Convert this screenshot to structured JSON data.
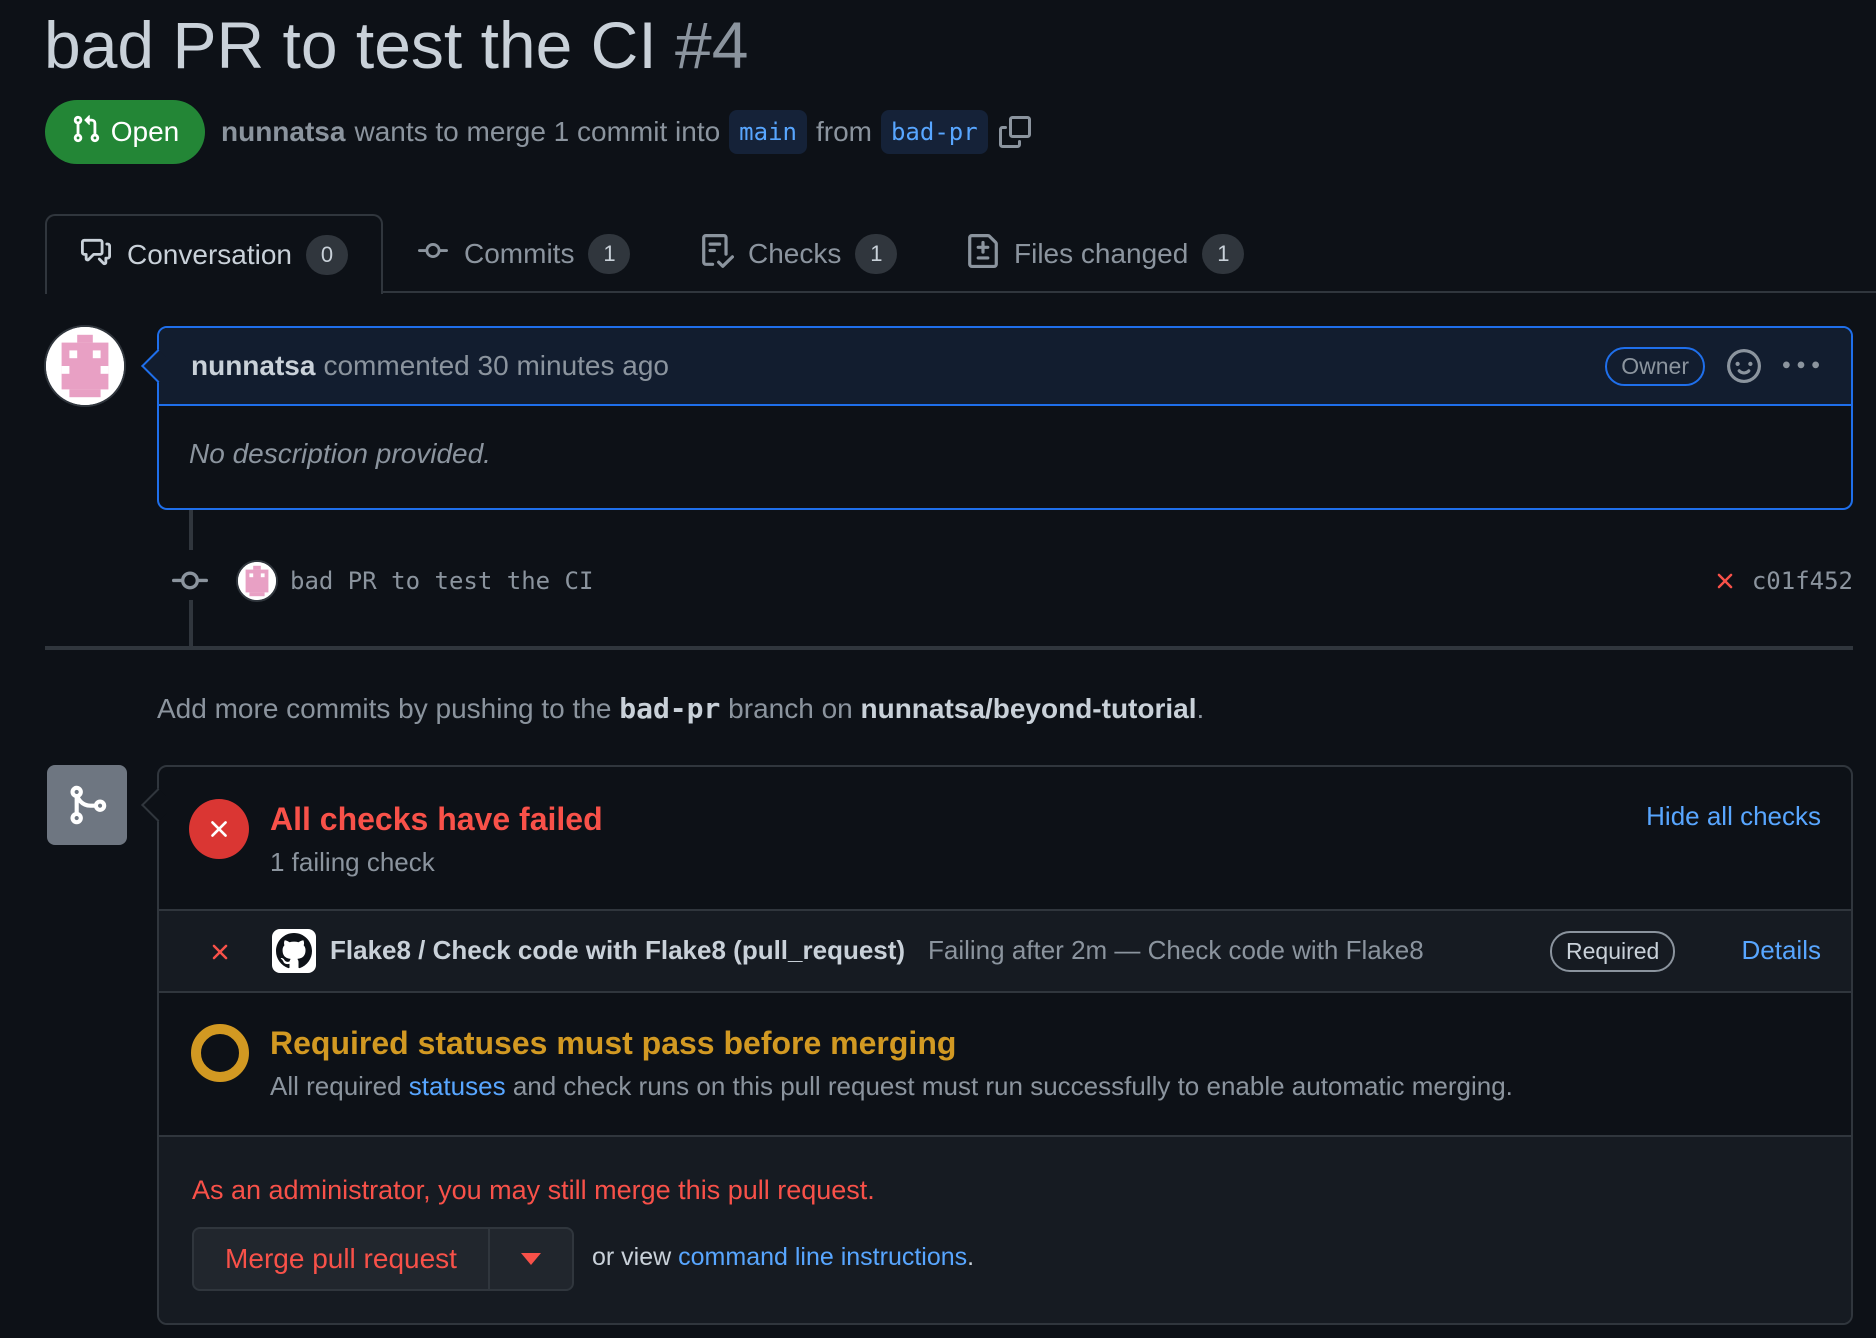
{
  "pr": {
    "title": "bad PR to test the CI",
    "number": "#4",
    "state": "Open",
    "author": "nunnatsa",
    "merge_text": "wants to merge 1 commit into",
    "base_branch": "main",
    "from_text": "from",
    "head_branch": "bad-pr"
  },
  "tabs": [
    {
      "label": "Conversation",
      "count": "0"
    },
    {
      "label": "Commits",
      "count": "1"
    },
    {
      "label": "Checks",
      "count": "1"
    },
    {
      "label": "Files changed",
      "count": "1"
    }
  ],
  "comment": {
    "author": "nunnatsa",
    "action": "commented 30 minutes ago",
    "role": "Owner",
    "body": "No description provided."
  },
  "commit": {
    "message": "bad PR to test the CI",
    "sha": "c01f452"
  },
  "push_note": {
    "prefix": "Add more commits by pushing to the",
    "branch": "bad-pr",
    "middle": "branch on",
    "repo": "nunnatsa/beyond-tutorial",
    "suffix": "."
  },
  "checks": {
    "title": "All checks have failed",
    "subtitle": "1 failing check",
    "hide_label": "Hide all checks",
    "item": {
      "name": "Flake8 / Check code with Flake8 (pull_request)",
      "description": "Failing after 2m — Check code with Flake8",
      "badge": "Required",
      "details_label": "Details"
    }
  },
  "required_status": {
    "title": "Required statuses must pass before merging",
    "text_before": "All required",
    "link": "statuses",
    "text_after": "and check runs on this pull request must run successfully to enable automatic merging."
  },
  "merge": {
    "admin_note": "As an administrator, you may still merge this pull request.",
    "button_label": "Merge pull request",
    "or_view": "or view",
    "cli_link": "command line instructions",
    "cli_suffix": "."
  },
  "colors": {
    "background": "#0d1117",
    "open_green": "#238636",
    "fail_red": "#f85149",
    "pending_yellow": "#d29922",
    "link_blue": "#58a6ff"
  }
}
